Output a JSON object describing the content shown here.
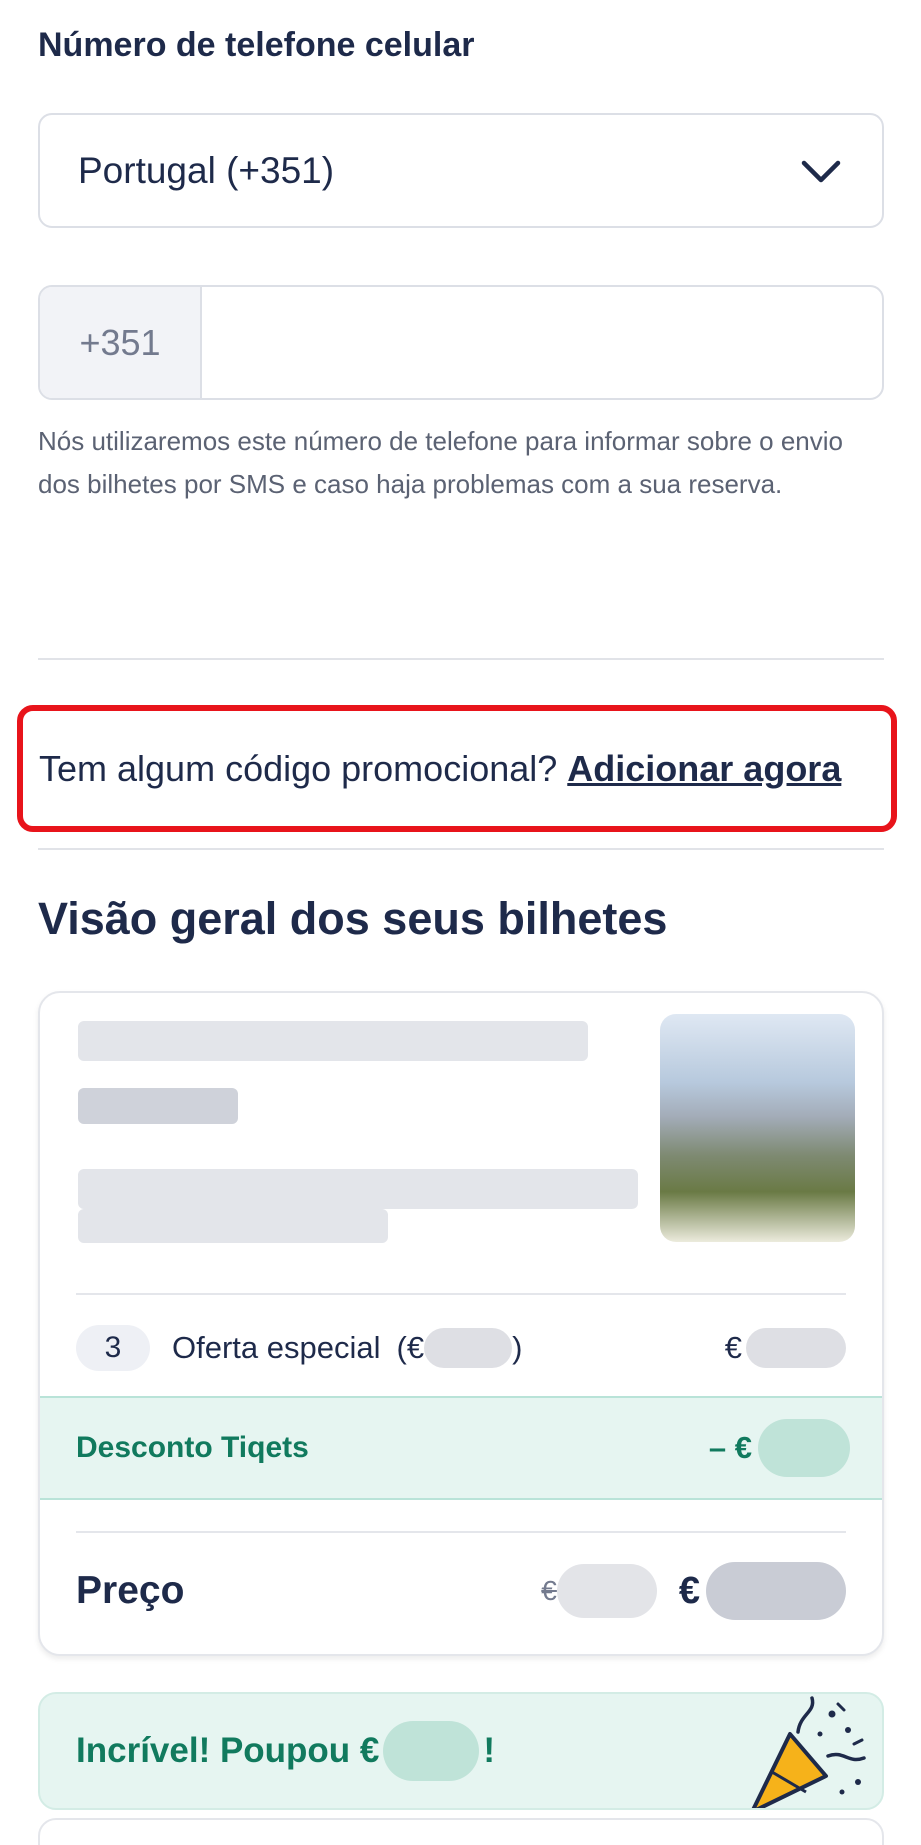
{
  "phone": {
    "label": "Número de telefone celular",
    "country_value": "Portugal (+351)",
    "prefix": "+351",
    "number_value": "",
    "helper_text": "Nós utilizaremos este número de telefone para informar sobre o envio dos bilhetes por SMS e caso haja problemas com a sua reserva."
  },
  "promo": {
    "question": "Tem algum código promocional?",
    "link_label": "Adicionar agora",
    "highlight_color": "#e8141b"
  },
  "overview": {
    "title": "Visão geral dos seus bilhetes",
    "line_item": {
      "quantity": "3",
      "label": "Oferta especial",
      "paren_open": "(€",
      "paren_close": ")",
      "currency": "€"
    },
    "discount": {
      "label": "Desconto Tiqets",
      "prefix": "– €"
    },
    "price": {
      "label": "Preço",
      "old_currency": "€",
      "new_currency": "€"
    }
  },
  "savings": {
    "text_before": "Incrível! Poupou €",
    "text_after": "!"
  },
  "colors": {
    "text_primary": "#1e2a4a",
    "accent_green": "#117a5e",
    "green_bg": "#e6f5f1"
  },
  "icons": {
    "dropdown": "chevron-down-icon",
    "celebration": "party-popper-icon"
  }
}
